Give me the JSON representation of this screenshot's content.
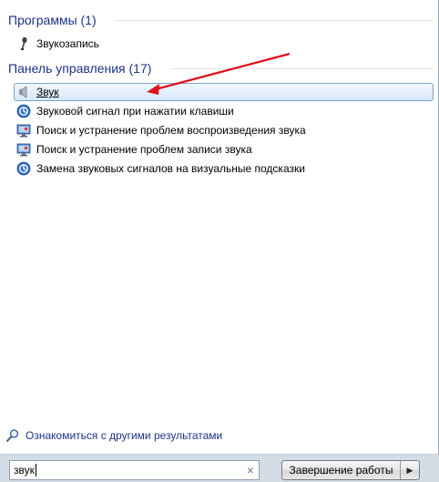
{
  "sections": {
    "programs": {
      "header": "Программы (1)",
      "items": [
        {
          "label": "Звукозапись",
          "icon": "microphone-icon"
        }
      ]
    },
    "control_panel": {
      "header": "Панель управления (17)",
      "items": [
        {
          "label": "Звук",
          "icon": "speaker-icon",
          "selected": true
        },
        {
          "label": "Звуковой сигнал при нажатии клавиши",
          "icon": "ease-of-access-icon"
        },
        {
          "label": "Поиск и устранение проблем воспроизведения звука",
          "icon": "troubleshoot-icon"
        },
        {
          "label": "Поиск и устранение проблем записи звука",
          "icon": "troubleshoot-icon"
        },
        {
          "label": "Замена звуковых сигналов на визуальные подсказки",
          "icon": "ease-of-access-icon"
        }
      ]
    }
  },
  "more_results": {
    "label": "Ознакомиться с другими результатами",
    "icon": "search-icon"
  },
  "search": {
    "value": "звук",
    "clear_icon": "×"
  },
  "shutdown": {
    "label": "Завершение работы",
    "arrow": "▶"
  },
  "colors": {
    "header_text": "#1e3287",
    "selection_border": "#7da2ce",
    "annotation_arrow": "#e0101a"
  }
}
